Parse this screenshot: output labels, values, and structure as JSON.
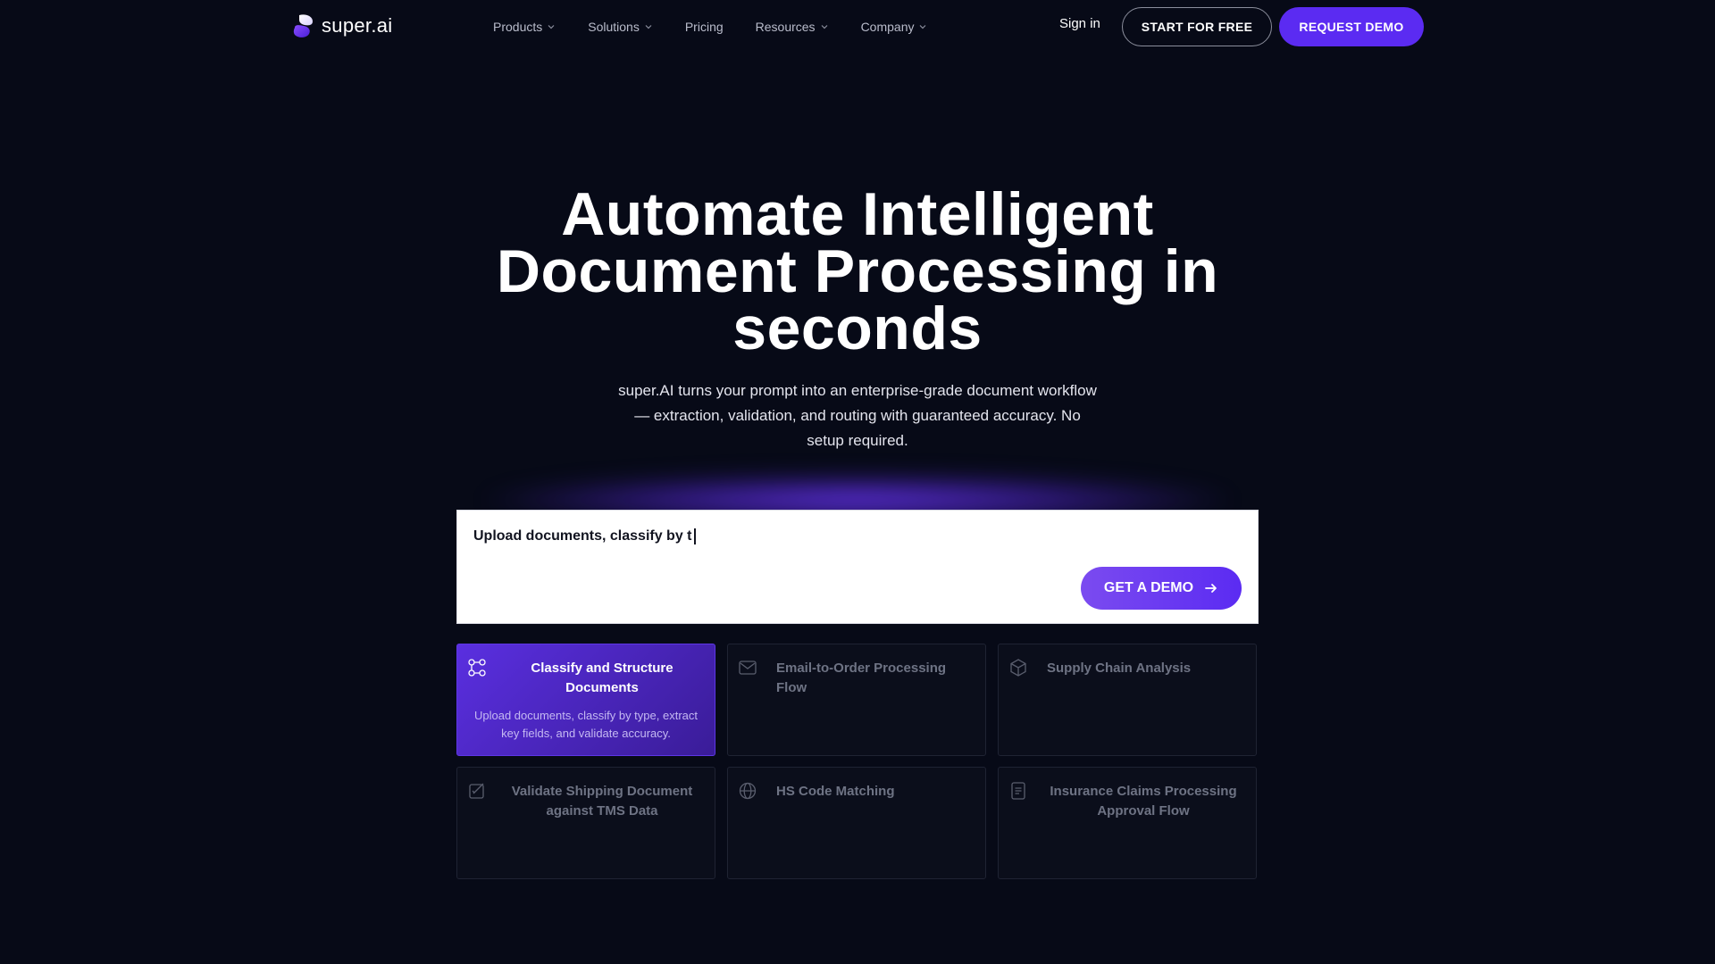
{
  "nav": {
    "logo_text": "super.ai",
    "links": [
      {
        "label": "Products",
        "dropdown": true
      },
      {
        "label": "Solutions",
        "dropdown": true
      },
      {
        "label": "Pricing",
        "dropdown": false
      },
      {
        "label": "Resources",
        "dropdown": true
      },
      {
        "label": "Company",
        "dropdown": true
      }
    ],
    "signin": "Sign in",
    "start_free": "START FOR FREE",
    "request_demo": "REQUEST DEMO"
  },
  "hero": {
    "title": "Automate Intelligent Document Processing in seconds",
    "subtitle": "super.AI turns your prompt into an enterprise-grade document workflow — extraction, validation, and routing with guaranteed accuracy. No setup required."
  },
  "prompt": {
    "typed_text": "Upload documents, classify by t",
    "button_label": "GET A DEMO"
  },
  "cards": [
    {
      "title": "Classify and Structure Documents",
      "description": "Upload documents, classify by type, extract key fields, and validate accuracy.",
      "icon": "flow-nodes-icon",
      "active": true
    },
    {
      "title": "Email-to-Order Processing Flow",
      "description": "",
      "icon": "mail-icon",
      "active": false
    },
    {
      "title": "Supply Chain Analysis",
      "description": "",
      "icon": "box-icon",
      "active": false
    },
    {
      "title": "Validate Shipping Document against TMS Data",
      "description": "",
      "icon": "edit-check-icon",
      "active": false
    },
    {
      "title": "HS Code Matching",
      "description": "",
      "icon": "globe-icon",
      "active": false
    },
    {
      "title": "Insurance Claims Processing Approval Flow",
      "description": "",
      "icon": "document-icon",
      "active": false
    }
  ],
  "colors": {
    "background": "#070a17",
    "accent": "#5b2bf2",
    "card_active_start": "#5a2fe0",
    "card_active_end": "#3a1c98"
  }
}
